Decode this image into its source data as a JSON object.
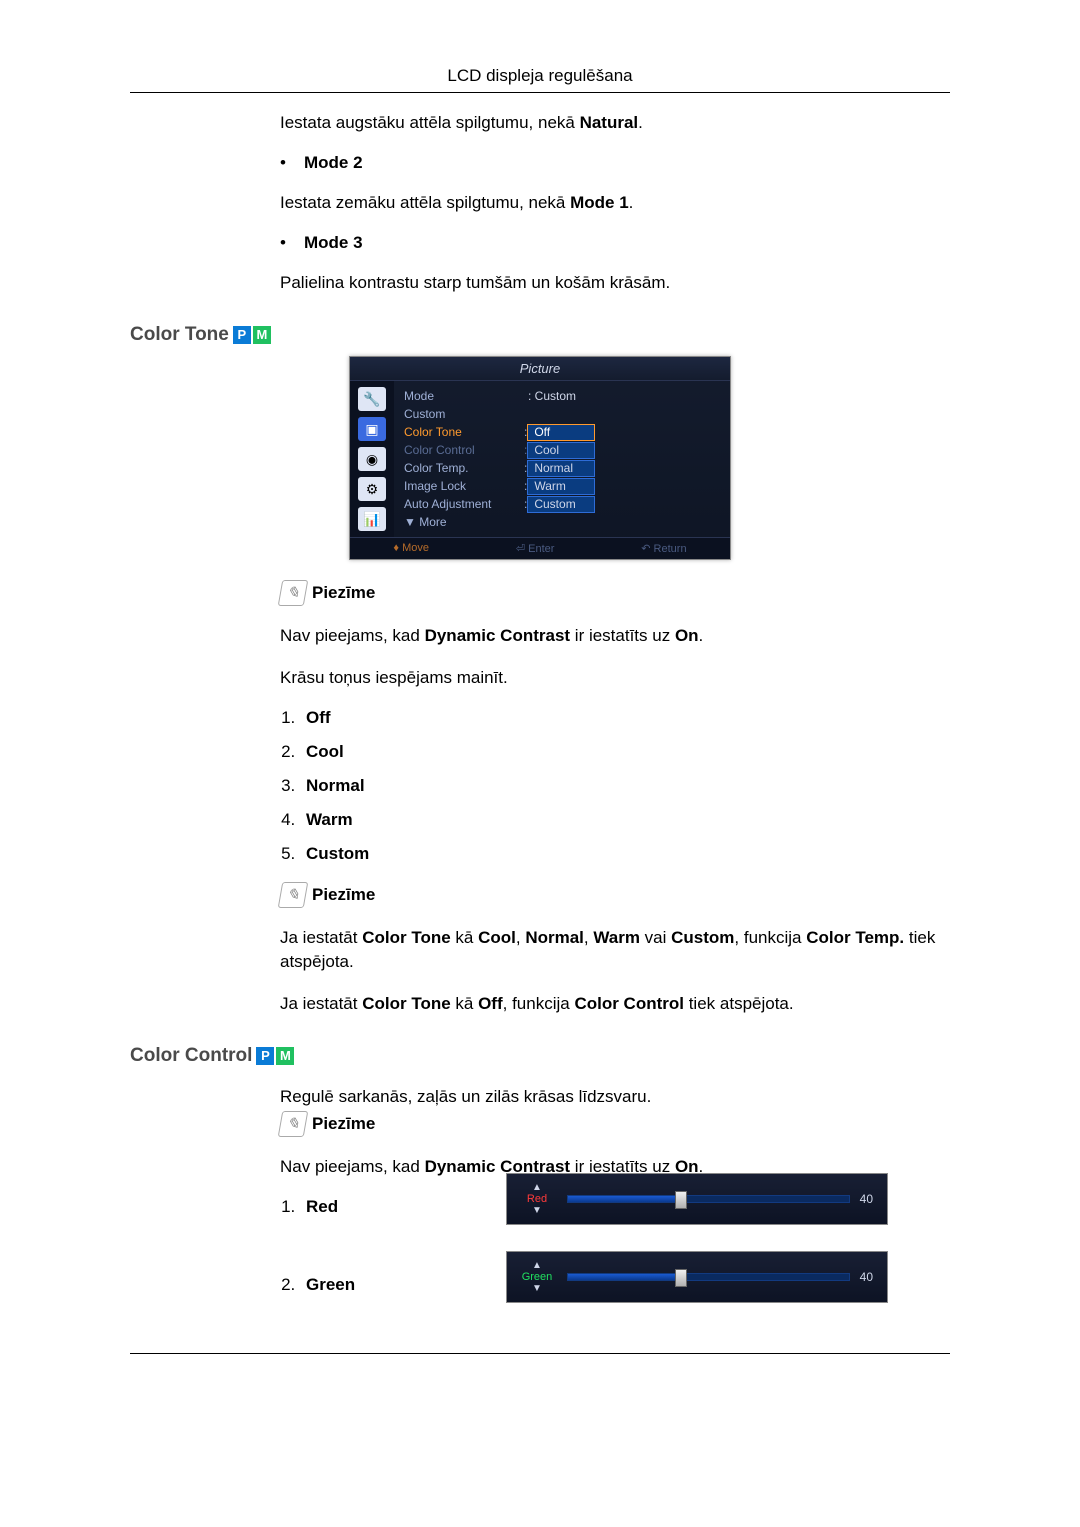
{
  "header": {
    "title": "LCD displeja regulēšana"
  },
  "intro_modes": {
    "natural_line_pre": "Iestata augstāku attēla spilgtumu, nekā ",
    "natural_bold": "Natural",
    "mode2_label": "Mode 2",
    "mode2_desc_pre": "Iestata zemāku attēla spilgtumu, nekā ",
    "mode2_desc_bold": "Mode 1",
    "mode3_label": "Mode 3",
    "mode3_desc": "Palielina kontrastu starp tumšām un košām krāsām."
  },
  "sections": {
    "color_tone": "Color Tone",
    "color_control": "Color Control"
  },
  "pm_badge": {
    "p": "P",
    "m": "M"
  },
  "osd": {
    "title": "Picture",
    "side_icons": [
      "🔧",
      "▣",
      "◉",
      "⚙",
      "📊"
    ],
    "rows": [
      {
        "label": "Mode",
        "value": ": Custom",
        "cls": ""
      },
      {
        "label": "Custom",
        "value": "",
        "cls": ""
      },
      {
        "label": "Color Tone",
        "opt": "Off",
        "cls": "orange",
        "hl": true
      },
      {
        "label": "Color Control",
        "opt": "Cool",
        "cls": "dim"
      },
      {
        "label": "Color Temp.",
        "opt": "Normal",
        "cls": ""
      },
      {
        "label": "Image Lock",
        "opt": "Warm",
        "cls": ""
      },
      {
        "label": "Auto Adjustment",
        "opt": "Custom",
        "cls": ""
      },
      {
        "label": "▼ More",
        "value": "",
        "cls": ""
      }
    ],
    "foot": {
      "move": "Move",
      "enter": "Enter",
      "return": "Return"
    }
  },
  "note_label": "Piezīme",
  "color_tone_text": {
    "not_avail_pre": "Nav pieejams, kad ",
    "dyn_contrast": "Dynamic Contrast",
    "not_avail_mid": " ir iestatīts uz ",
    "on_word": "On",
    "change_line": "Krāsu toņus iespējams mainīt.",
    "options": [
      "Off",
      "Cool",
      "Normal",
      "Warm",
      "Custom"
    ],
    "note2_pre": "Ja iestatāt ",
    "note2_ct": "Color Tone",
    "note2_mid1": " kā ",
    "note2_cnw": "Cool",
    "note2_c2": "Normal",
    "note2_c3": "Warm",
    "note2_or": " vai ",
    "note2_c4": "Custom",
    "note2_tail1": ", funkcija ",
    "note2_ctemp": "Color Temp.",
    "note2_tail2": " tiek atspējota.",
    "note3_pre": "Ja iestatāt ",
    "note3_mid": " kā ",
    "note3_off": "Off",
    "note3_tail1": ", funkcija ",
    "note3_cc": "Color Control",
    "note3_tail2": " tiek atspējota."
  },
  "color_control_text": {
    "desc": "Regulē sarkanās, zaļās un zilās krāsas līdzsvaru.",
    "items": [
      "Red",
      "Green"
    ]
  },
  "sliders": {
    "red": {
      "label": "Red",
      "value": "40"
    },
    "green": {
      "label": "Green",
      "value": "40"
    }
  },
  "chart_data": [
    {
      "type": "bar",
      "title": "Red",
      "categories": [
        "Red"
      ],
      "values": [
        40
      ],
      "ylim": [
        0,
        100
      ]
    },
    {
      "type": "bar",
      "title": "Green",
      "categories": [
        "Green"
      ],
      "values": [
        40
      ],
      "ylim": [
        0,
        100
      ]
    }
  ]
}
